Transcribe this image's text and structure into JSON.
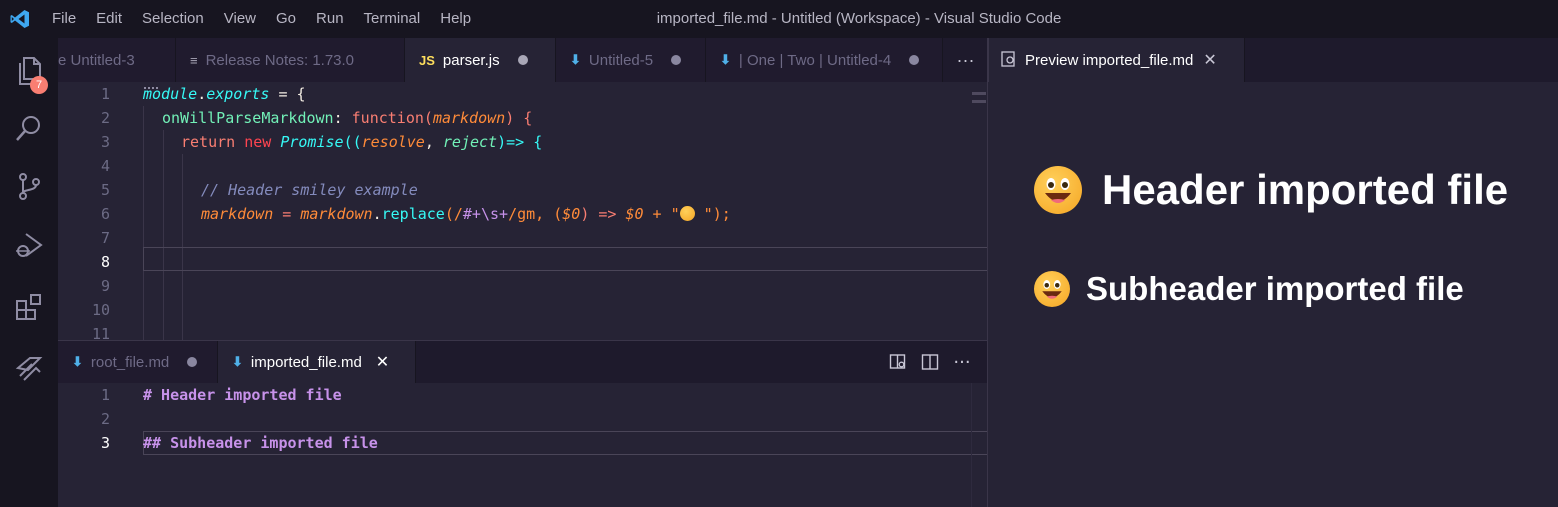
{
  "window": {
    "title": "imported_file.md - Untitled (Workspace) - Visual Studio Code"
  },
  "menu": [
    "File",
    "Edit",
    "Selection",
    "View",
    "Go",
    "Run",
    "Terminal",
    "Help"
  ],
  "activity_bar": {
    "items": [
      "explorer-icon",
      "search-icon",
      "source-control-icon",
      "run-debug-icon",
      "extensions-icon",
      "remote-icon"
    ],
    "explorer_badge": "7"
  },
  "top_group": {
    "tabs": [
      {
        "label": "e Untitled-3",
        "icon": "",
        "dirty": false
      },
      {
        "label": "Release Notes: 1.73.0",
        "icon": "≡",
        "dirty": false
      },
      {
        "label": "parser.js",
        "icon": "JS",
        "dirty": true,
        "active": true
      },
      {
        "label": "Untitled-5",
        "icon": "⬇",
        "dirty": true
      },
      {
        "label": "| One | Two |  Untitled-4",
        "icon": "⬇",
        "dirty": true
      }
    ],
    "more": "···",
    "line_numbers": [
      "1",
      "2",
      "3",
      "4",
      "5",
      "6",
      "7",
      "8",
      "9",
      "10",
      "11"
    ],
    "current_line": "8",
    "code": {
      "l1_a": "module",
      "l1_b": ".",
      "l1_c": "exports",
      "l1_d": " = {",
      "l2_a": "onWillParseMarkdown",
      "l2_b": ": ",
      "l2_c": "function",
      "l2_d": "(",
      "l2_e": "markdown",
      "l2_f": ") {",
      "l3_a": "return ",
      "l3_b": "new ",
      "l3_c": "Promise",
      "l3_d": "((",
      "l3_e": "resolve",
      "l3_f": ", ",
      "l3_g": "reject",
      "l3_h": ")=> {",
      "l5": "// Header smiley example",
      "l6_a": "markdown",
      "l6_b": " = ",
      "l6_c": "markdown",
      "l6_d": ".",
      "l6_e": "replace",
      "l6_f": "(/",
      "l6_g": "#+\\s+",
      "l6_h": "/gm, (",
      "l6_i": "$0",
      "l6_j": ") => ",
      "l6_k": "$0",
      "l6_l": " + \"",
      "l6_m": " \");"
    }
  },
  "bottom_group": {
    "tabs": [
      {
        "label": "root_file.md",
        "dirty": true
      },
      {
        "label": "imported_file.md",
        "active": true,
        "close": "✕"
      }
    ],
    "line_numbers": [
      "1",
      "2",
      "3"
    ],
    "current_line": "3",
    "lines": [
      "# Header imported file",
      "",
      "## Subheader imported file"
    ]
  },
  "preview": {
    "tab_label": "Preview imported_file.md",
    "close": "✕",
    "h1": "Header imported file",
    "h2": "Subheader imported file"
  },
  "colors": {
    "background": "#262335",
    "titlebar": "#171520",
    "accent_cyan": "#36f9f6",
    "accent_yellow": "#fede5d",
    "markdown_heading": "#c792ea",
    "badge": "#f97e72"
  }
}
